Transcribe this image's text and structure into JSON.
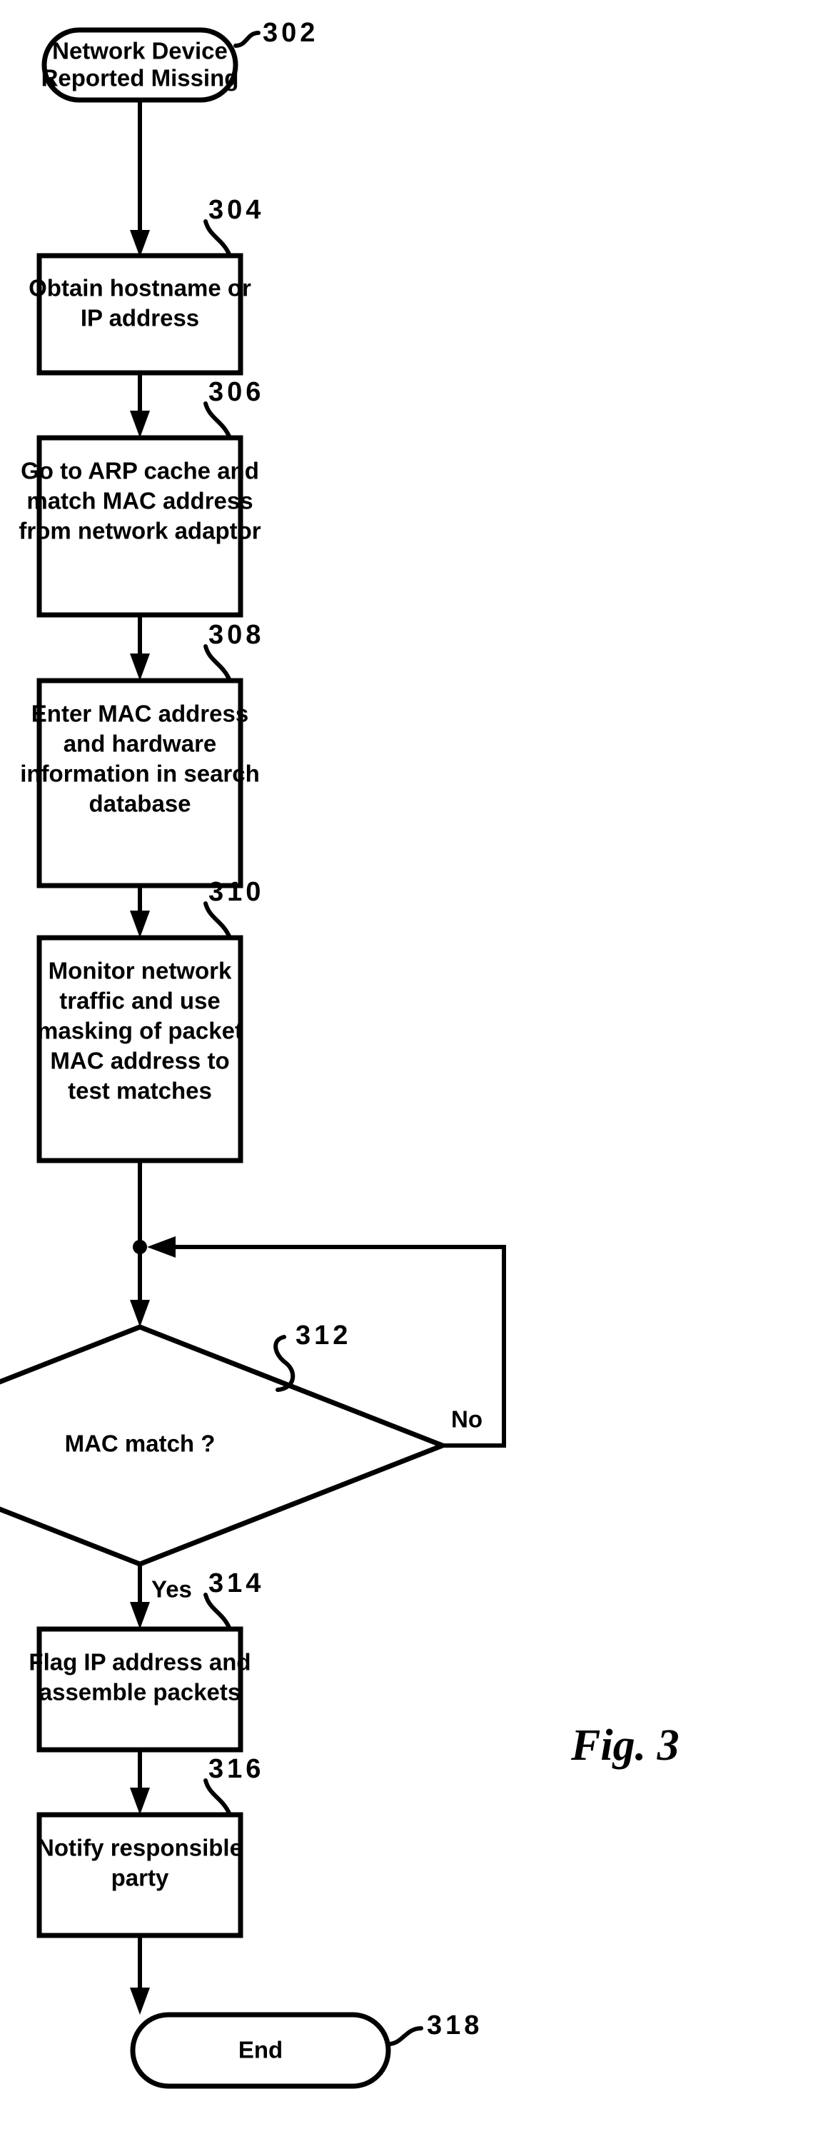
{
  "figure": {
    "label": "Fig.  3",
    "title": "Network Device Reported Missing Flowchart"
  },
  "nodes": {
    "start": {
      "ref": "302",
      "shape": "stadium",
      "line1": "Network Device",
      "line2": "Reported Missing"
    },
    "step_304": {
      "ref": "304",
      "shape": "rectangle",
      "line1": "Obtain hostname or",
      "line2": "IP address"
    },
    "step_306": {
      "ref": "306",
      "shape": "rectangle",
      "line1": "Go to ARP cache and",
      "line2": "match MAC address",
      "line3": "from network adaptor"
    },
    "step_308": {
      "ref": "308",
      "shape": "rectangle",
      "line1": "Enter MAC address",
      "line2": "and hardware",
      "line3": "information in search",
      "line4": "database"
    },
    "step_310": {
      "ref": "310",
      "shape": "rectangle",
      "line1": "Monitor network",
      "line2": "traffic and use",
      "line3": "masking of packet",
      "line4": "MAC address to",
      "line5": "test matches"
    },
    "decision_312": {
      "ref": "312",
      "shape": "diamond",
      "line1": "MAC match ?"
    },
    "step_314": {
      "ref": "314",
      "shape": "rectangle",
      "line1": "Flag IP address and",
      "line2": "assemble packets"
    },
    "step_316": {
      "ref": "316",
      "shape": "rectangle",
      "line1": "Notify responsible",
      "line2": "party"
    },
    "end": {
      "ref": "318",
      "shape": "stadium",
      "line1": "End"
    }
  },
  "edges": {
    "no_label": "No",
    "yes_label": "Yes"
  },
  "colors": {
    "ink": "#000000",
    "paper": "#ffffff"
  }
}
